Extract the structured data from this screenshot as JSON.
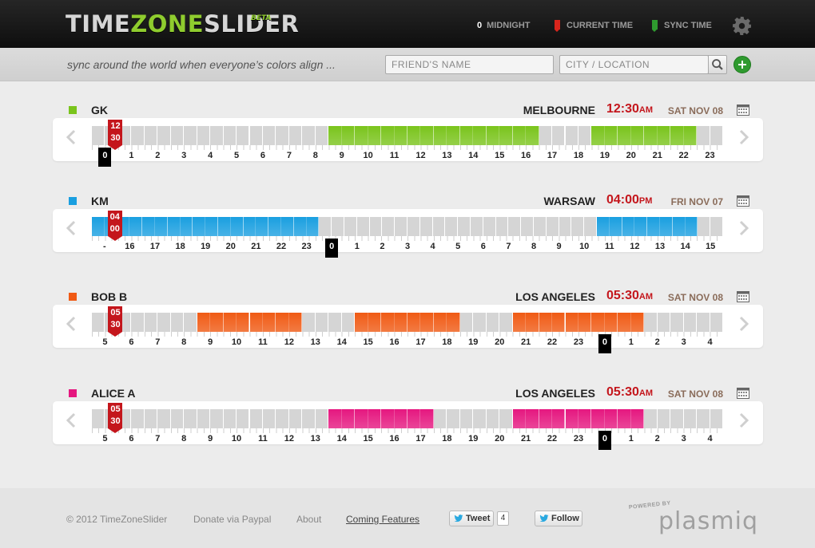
{
  "app": {
    "logo_prefix": "TIME",
    "logo_mid": "ZONE",
    "logo_suffix": "SLIDER",
    "badge": "BETA"
  },
  "header": {
    "legend": [
      {
        "prefix": "0",
        "label": "MIDNIGHT"
      },
      {
        "label": "CURRENT TIME",
        "color": "#d9251c",
        "icon": "red-flag-icon"
      },
      {
        "label": "SYNC TIME",
        "color": "#2f9a2f",
        "icon": "green-flag-icon"
      }
    ],
    "settings_icon": "gear-icon"
  },
  "search": {
    "tagline": "sync around the world when everyone’s colors align ...",
    "friend_placeholder": "FRIEND'S NAME",
    "city_placeholder": "CITY / LOCATION",
    "search_icon": "magnifier-icon",
    "add_icon": "plus-icon"
  },
  "people": [
    {
      "name": "GK",
      "color": "#7ac41c",
      "city": "MELBOURNE",
      "time": "12:30",
      "ampm": "AM",
      "date": "SAT NOV 08",
      "marker_hour": "12",
      "marker_min": "30",
      "hours": [
        "0",
        "1",
        "2",
        "3",
        "4",
        "5",
        "6",
        "7",
        "8",
        "9",
        "10",
        "11",
        "12",
        "13",
        "14",
        "15",
        "16",
        "17",
        "18",
        "19",
        "20",
        "21",
        "22",
        "23"
      ],
      "midnight_index": 0,
      "active_cells": [
        [
          9,
          17
        ],
        [
          19,
          23
        ]
      ]
    },
    {
      "name": "KM",
      "color": "#1a9fe0",
      "city": "WARSAW",
      "time": "04:00",
      "ampm": "PM",
      "date": "FRI NOV 07",
      "marker_hour": "04",
      "marker_min": "00",
      "hours": [
        "-",
        "16",
        "17",
        "18",
        "19",
        "20",
        "21",
        "22",
        "23",
        "0",
        "1",
        "2",
        "3",
        "4",
        "5",
        "6",
        "7",
        "8",
        "9",
        "10",
        "11",
        "12",
        "13",
        "14",
        "15"
      ],
      "midnight_index": 9,
      "active_cells": [
        [
          0,
          9
        ],
        [
          20,
          24
        ]
      ]
    },
    {
      "name": "BOB B",
      "color": "#f05a14",
      "city": "LOS ANGELES",
      "time": "05:30",
      "ampm": "AM",
      "date": "SAT NOV 08",
      "marker_hour": "05",
      "marker_min": "30",
      "hours": [
        "5",
        "6",
        "7",
        "8",
        "9",
        "10",
        "11",
        "12",
        "13",
        "14",
        "15",
        "16",
        "17",
        "18",
        "19",
        "20",
        "21",
        "22",
        "23",
        "0",
        "1",
        "2",
        "3",
        "4"
      ],
      "midnight_index": 19,
      "active_cells": [
        [
          4,
          8
        ],
        [
          10,
          14
        ],
        [
          16,
          21
        ]
      ]
    },
    {
      "name": "ALICE A",
      "color": "#e5177f",
      "city": "LOS ANGELES",
      "time": "05:30",
      "ampm": "AM",
      "date": "SAT NOV 08",
      "marker_hour": "05",
      "marker_min": "30",
      "hours": [
        "5",
        "6",
        "7",
        "8",
        "9",
        "10",
        "11",
        "12",
        "13",
        "14",
        "15",
        "16",
        "17",
        "18",
        "19",
        "20",
        "21",
        "22",
        "23",
        "0",
        "1",
        "2",
        "3",
        "4"
      ],
      "midnight_index": 19,
      "active_cells": [
        [
          9,
          13
        ],
        [
          16,
          21
        ]
      ]
    }
  ],
  "footer": {
    "copyright": "© 2012 TimeZoneSlider",
    "donate": "Donate via Paypal",
    "about": "About",
    "coming": "Coming Features",
    "tweet": "Tweet",
    "tweet_count": "4",
    "follow": "Follow",
    "powered": "POWERED BY",
    "brand": "plasmiq"
  }
}
